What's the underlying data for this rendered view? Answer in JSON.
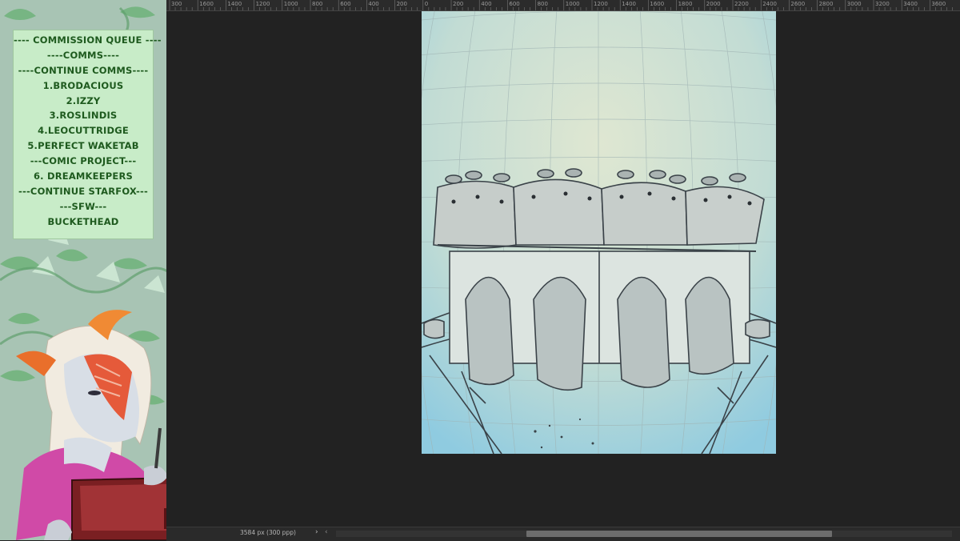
{
  "queue": {
    "lines": [
      "---- COMMISSION QUEUE ----",
      "----COMMS----",
      "----CONTINUE COMMS----",
      "1.BRODACIOUS",
      "2.IZZY",
      "3.ROSLINDIS",
      "4.LEOCUTTRIDGE",
      "5.PERFECT WAKETAB",
      "---COMIC PROJECT---",
      "6. DREAMKEEPERS",
      "---CONTINUE STARFOX---",
      "---SFW---",
      "BUCKETHEAD"
    ]
  },
  "ruler": {
    "labels": [
      "300",
      "1600",
      "1400",
      "1200",
      "1000",
      "800",
      "600",
      "400",
      "200",
      "0",
      "200",
      "400",
      "600",
      "800",
      "1000",
      "1200",
      "1400",
      "1600",
      "1800",
      "2000",
      "2200",
      "2400",
      "2600",
      "2800",
      "3000",
      "3200",
      "3400",
      "3600"
    ]
  },
  "status": {
    "size": "3584 px (300 ppp)",
    "nav_next": "›",
    "nav_prev": "‹"
  },
  "colors": {
    "queue_text": "#1e5a1e",
    "queue_bg": "#c8ecc8",
    "workspace": "#222222",
    "canvas_top": "#d4e3cf",
    "canvas_bottom": "#9fd0e0"
  },
  "icons": {
    "nav_next": "chevron-right-icon",
    "nav_prev": "chevron-left-icon"
  }
}
